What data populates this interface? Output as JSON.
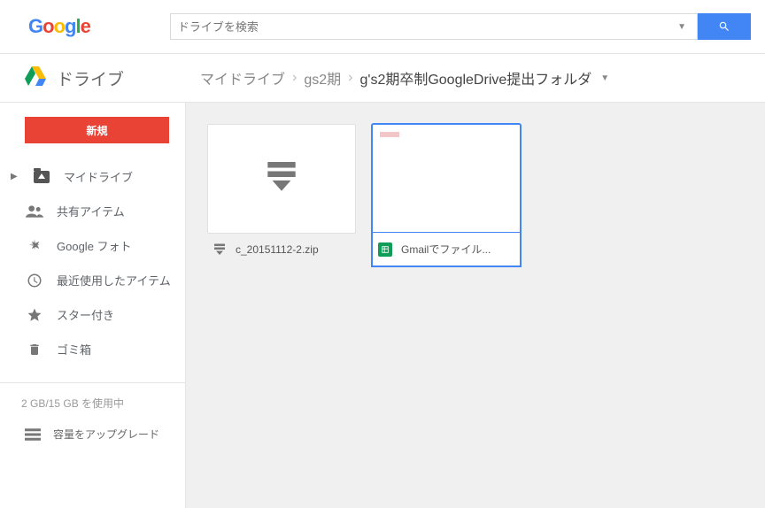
{
  "header": {
    "search_placeholder": "ドライブを検索"
  },
  "app": {
    "name": "ドライブ"
  },
  "breadcrumb": {
    "items": [
      "マイドライブ",
      "gs2期",
      "g's2期卒制GoogleDrive提出フォルダ"
    ]
  },
  "sidebar": {
    "new_label": "新規",
    "items": {
      "mydrive": "マイドライブ",
      "shared": "共有アイテム",
      "photos": "Google フォト",
      "recent": "最近使用したアイテム",
      "starred": "スター付き",
      "trash": "ゴミ箱"
    },
    "storage_text": "2 GB/15 GB を使用中",
    "upgrade_text": "容量をアップグレード"
  },
  "files": {
    "zip": {
      "name": "c_20151112-2.zip"
    },
    "sheet": {
      "name": "Gmailでファイル..."
    }
  }
}
